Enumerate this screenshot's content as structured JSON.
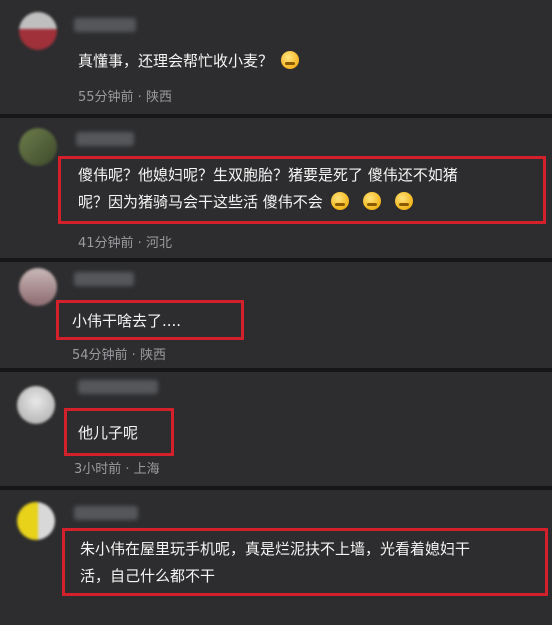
{
  "comments": [
    {
      "text_lines": [
        "真懂事，还理会帮忙收小麦？"
      ],
      "emoji": [
        "laugh-crying-emoji"
      ],
      "meta": "55分钟前 · 陕西"
    },
    {
      "text_lines": [
        "傻伟呢？他媳妇呢？生双胞胎？猪要是死了 傻伟还不如猪",
        "呢？因为猪骑马会干这些活  傻伟不会"
      ],
      "emoji": [
        "thinking-emoji",
        "thinking-emoji",
        "thinking-emoji"
      ],
      "meta": "41分钟前 · 河北"
    },
    {
      "text_lines": [
        "小伟干啥去了...."
      ],
      "meta": "54分钟前 · 陕西"
    },
    {
      "text_lines": [
        "他儿子呢"
      ],
      "meta": "3小时前 · 上海"
    },
    {
      "text_lines": [
        "朱小伟在屋里玩手机呢，真是烂泥扶不上墙，光看着媳妇干",
        "活，自己什么都不干"
      ]
    }
  ],
  "colors": {
    "highlight": "#d4202a",
    "background": "#2d2d2f",
    "meta_text": "#9a9a9e"
  }
}
